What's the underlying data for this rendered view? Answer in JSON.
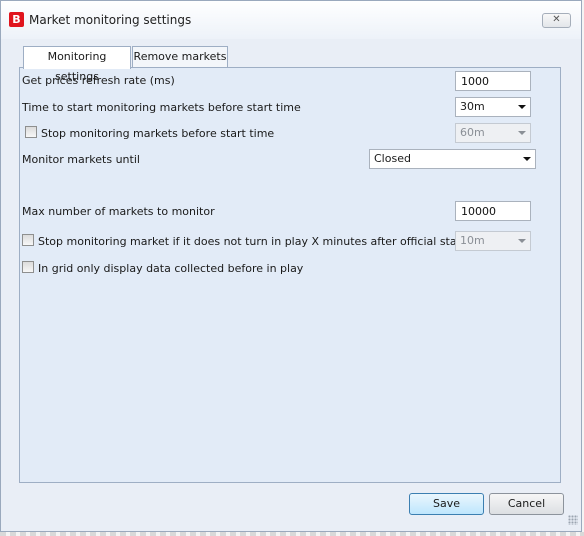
{
  "window": {
    "title": "Market monitoring settings",
    "icon_letter": "B",
    "close_label": "✕"
  },
  "tabs": [
    {
      "label": "Monitoring settings",
      "active": true
    },
    {
      "label": "Remove markets",
      "active": false
    }
  ],
  "settings": {
    "refresh_rate_label": "Get prices refresh rate (ms)",
    "refresh_rate_value": "1000",
    "start_time_label": "Time to start monitoring markets before start time",
    "start_time_value": "30m",
    "stop_before_label": "Stop monitoring markets before start time",
    "stop_before_value": "60m",
    "monitor_until_label": "Monitor markets until",
    "monitor_until_value": "Closed",
    "max_markets_label": "Max number of markets to monitor",
    "max_markets_value": "10000",
    "stop_not_inplay_label": "Stop monitoring market if it does not turn in play X minutes after official start time",
    "stop_not_inplay_value": "10m",
    "grid_before_inplay_label": "In grid only display data collected before in play"
  },
  "buttons": {
    "save": "Save",
    "cancel": "Cancel"
  },
  "colors": {
    "accent_red": "#e0141d",
    "panel_bg": "#e2ebf7"
  }
}
